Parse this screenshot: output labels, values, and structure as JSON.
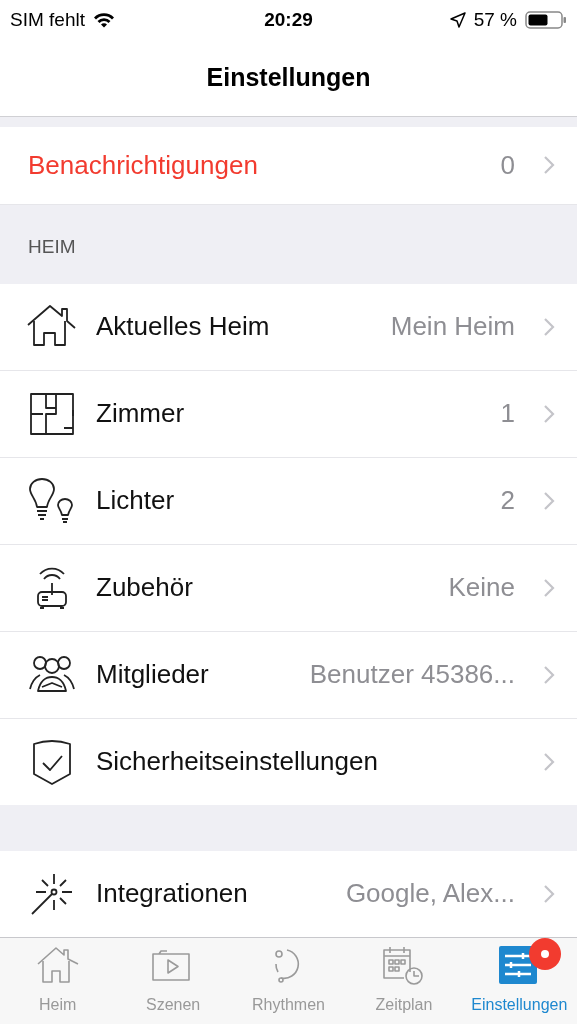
{
  "status_bar": {
    "carrier": "SIM fehlt",
    "time": "20:29",
    "battery": "57 %"
  },
  "nav": {
    "title": "Einstellungen"
  },
  "notifications": {
    "label": "Benachrichtigungen",
    "value": "0"
  },
  "sections": [
    {
      "header": "HEIM",
      "rows": [
        {
          "label": "Aktuelles Heim",
          "value": "Mein Heim"
        },
        {
          "label": "Zimmer",
          "value": "1"
        },
        {
          "label": "Lichter",
          "value": "2"
        },
        {
          "label": "Zubehör",
          "value": "Keine"
        },
        {
          "label": "Mitglieder",
          "value": "Benutzer 45386..."
        },
        {
          "label": "Sicherheitseinstellungen"
        }
      ]
    },
    {
      "rows": [
        {
          "label": "Integrationen",
          "value": "Google, Alex..."
        }
      ]
    }
  ],
  "tabs": [
    {
      "label": "Heim",
      "selected": false,
      "badge": false
    },
    {
      "label": "Szenen",
      "selected": false,
      "badge": false
    },
    {
      "label": "Rhythmen",
      "selected": false,
      "badge": false
    },
    {
      "label": "Zeitplan",
      "selected": false,
      "badge": false
    },
    {
      "label": "Einstellungen",
      "selected": true,
      "badge": true
    }
  ]
}
